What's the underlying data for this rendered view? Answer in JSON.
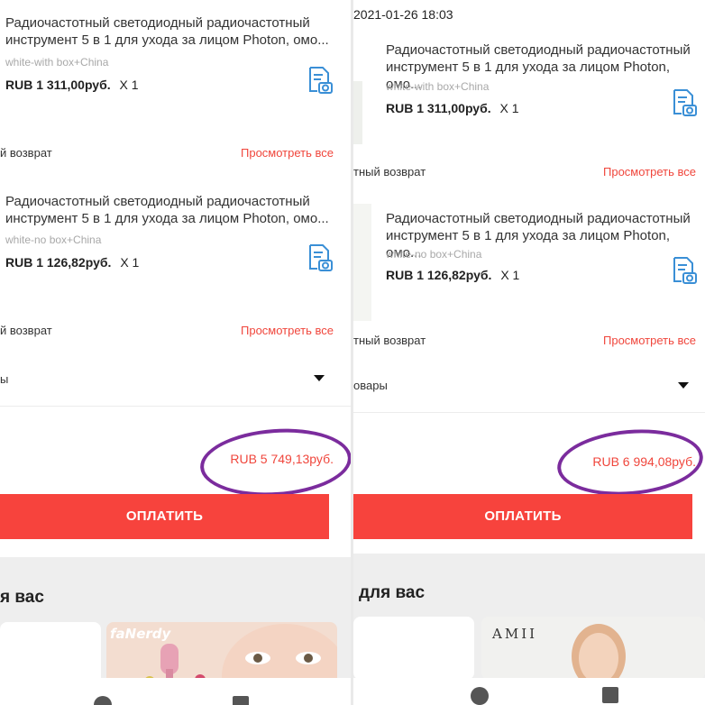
{
  "left": {
    "items": [
      {
        "title": "Радиочастотный светодиодный радиочастотный инструмент 5 в 1 для ухода за лицом Photon, омо...",
        "variant": "white-with box+China",
        "price": "RUB 1 311,00руб.",
        "qty": "X 1"
      },
      {
        "title": "Радиочастотный светодиодный радиочастотный инструмент 5 в 1 для ухода за лицом Photon, омо...",
        "variant": "white-no box+China",
        "price": "RUB 1 126,82руб.",
        "qty": "X 1"
      }
    ],
    "return_labels": [
      "й возврат",
      "й возврат"
    ],
    "view_all": [
      "Просмотреть все",
      "Просмотреть все"
    ],
    "goods_label": "ы",
    "total": "RUB 5 749,13руб.",
    "pay_button": "ОПЛАТИТЬ",
    "for_you": "я вас",
    "card_brand": "faNerdy"
  },
  "right": {
    "timestamp": "2021-01-26 18:03",
    "items": [
      {
        "title": "Радиочастотный светодиодный радиочастотный инструмент 5 в 1 для ухода за лицом Photon, омо...",
        "variant": "white-with box+China",
        "price": "RUB 1 311,00руб.",
        "qty": "X 1"
      },
      {
        "title": "Радиочастотный светодиодный радиочастотный инструмент 5 в 1 для ухода за лицом Photon, омо...",
        "variant": "white-no box+China",
        "price": "RUB 1 126,82руб.",
        "qty": "X 1"
      }
    ],
    "return_labels": [
      "тный возврат",
      "тный возврат"
    ],
    "view_all": [
      "Просмотреть все",
      "Просмотреть все"
    ],
    "goods_label": "овары",
    "total": "RUB 6 994,08руб.",
    "pay_button": "ОПЛАТИТЬ",
    "for_you": "для вас",
    "card_brand": "AMII"
  },
  "colors": {
    "accent": "#f0463c",
    "pay_button": "#f7433d",
    "annotation": "#7b2c9d",
    "icon": "#3a8fd6"
  },
  "icons": {
    "document_photo": "receipt-camera-icon",
    "caret": "caret-down-icon",
    "nav_home": "circle-home-icon",
    "nav_recent": "square-recent-icon"
  }
}
